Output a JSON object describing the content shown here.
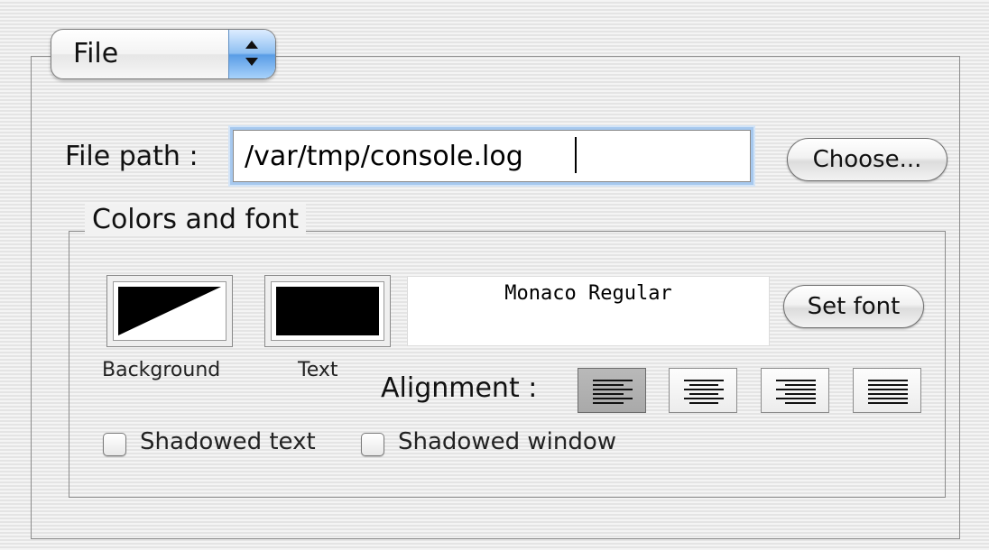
{
  "source_popup": {
    "selected_label": "File"
  },
  "file_path": {
    "label": "File path :",
    "value": "/var/tmp/console.log",
    "choose_button": "Choose..."
  },
  "colors_and_font": {
    "group_title": "Colors and font",
    "background_label": "Background",
    "text_label": "Text",
    "font_preview": "Monaco Regular",
    "set_font_button": "Set font",
    "alignment_label": "Alignment :",
    "alignment_options": [
      "left",
      "center",
      "right",
      "justify"
    ],
    "selected_alignment": "left",
    "shadowed_text": {
      "label": "Shadowed text",
      "checked": false
    },
    "shadowed_window": {
      "label": "Shadowed window",
      "checked": false
    },
    "background_colors": [
      "#000000",
      "#ffffff"
    ],
    "text_color": "#000000"
  },
  "accent_color": "#5a9de6"
}
